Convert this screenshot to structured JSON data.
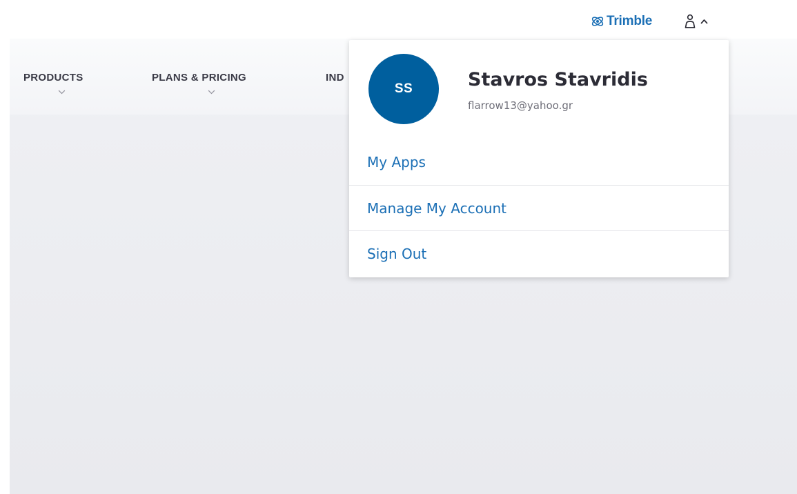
{
  "header": {
    "brand": "Trimble",
    "brand_icon": "trimble-globe-icon",
    "user_icon": "user-icon",
    "toggle_icon": "caret-up-icon",
    "accent_color": "#1b6fb5"
  },
  "nav": {
    "items": [
      {
        "label": "PRODUCTS",
        "icon": "chevron-down-icon"
      },
      {
        "label": "PLANS & PRICING",
        "icon": "chevron-down-icon"
      },
      {
        "label": "IND"
      }
    ]
  },
  "user_menu": {
    "avatar_initials": "SS",
    "avatar_color": "#005f9e",
    "name": "Stavros Stavridis",
    "email": "flarrow13@yahoo.gr",
    "items": [
      {
        "label": "My Apps"
      },
      {
        "label": "Manage My Account"
      },
      {
        "label": "Sign Out"
      }
    ]
  }
}
